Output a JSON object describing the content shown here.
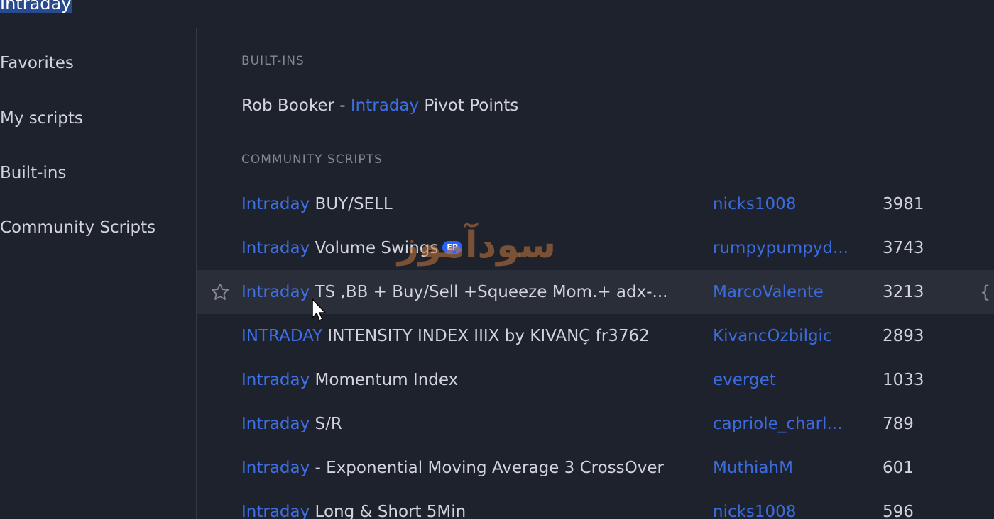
{
  "search": {
    "value": "Intraday"
  },
  "sidebar": {
    "items": [
      {
        "label": "Favorites"
      },
      {
        "label": "My scripts"
      },
      {
        "label": "Built-ins"
      },
      {
        "label": "Community Scripts"
      }
    ]
  },
  "builtins": {
    "header": "BUILT-INS",
    "items": [
      {
        "prefix": "Rob Booker - ",
        "highlight": "Intraday",
        "suffix": " Pivot Points"
      }
    ]
  },
  "community": {
    "header": "COMMUNITY SCRIPTS",
    "items": [
      {
        "highlight": "Intraday",
        "suffix": " BUY/SELL",
        "author": "nicks1008",
        "count": "3981"
      },
      {
        "highlight": "Intraday",
        "suffix": " Volume Swings",
        "badge": "EP",
        "author": "rumpypumpyd...",
        "count": "3743"
      },
      {
        "highlight": "Intraday",
        "suffix": " TS ,BB + Buy/Sell +Squeeze Mom.+ adx-...",
        "author": "MarcoValente",
        "count": "3213"
      },
      {
        "highlight": "INTRADAY",
        "suffix": " INTENSITY INDEX IIIX by KIVANÇ fr3762",
        "author": "KivancOzbilgic",
        "count": "2893"
      },
      {
        "highlight": "Intraday",
        "suffix": " Momentum Index",
        "author": "everget",
        "count": "1033"
      },
      {
        "highlight": "Intraday",
        "suffix": " S/R",
        "author": "capriole_charl...",
        "count": "789"
      },
      {
        "highlight": "Intraday",
        "suffix": " - Exponential Moving Average 3 CrossOver",
        "author": "MuthiahM",
        "count": "601"
      },
      {
        "highlight": "Intraday",
        "suffix": " Long & Short 5Min",
        "author": "nicks1008",
        "count": "596"
      }
    ]
  },
  "watermark": "سودآموز",
  "icons": {
    "star": "star-outline-icon",
    "edge": "curly-brace-icon",
    "cursor": "mouse-pointer-icon"
  },
  "colors": {
    "background": "#1e222d",
    "highlight": "#3d6fe6",
    "hover_row": "#2a2e39",
    "badge": "#2962ff"
  }
}
